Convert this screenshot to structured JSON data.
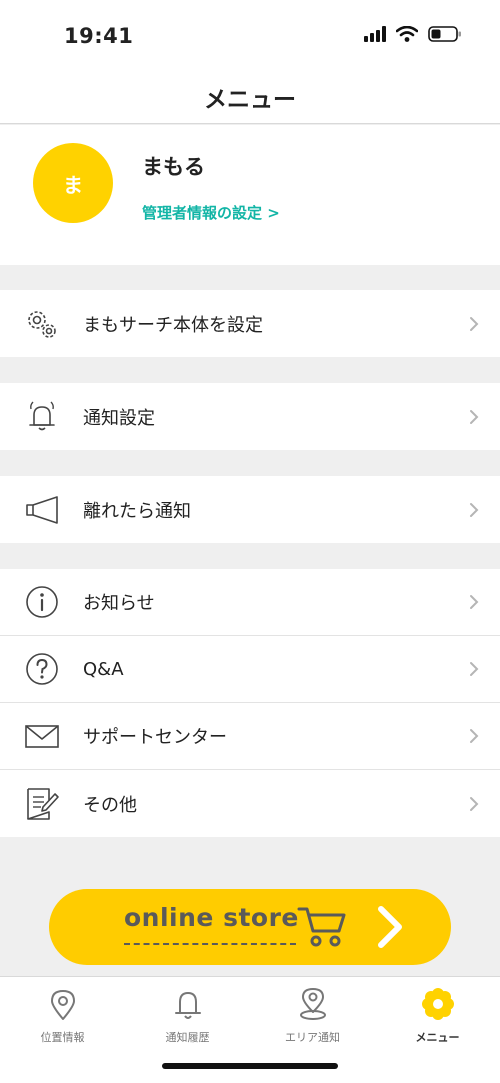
{
  "status_bar": {
    "time": "19:41"
  },
  "nav": {
    "title": "メニュー"
  },
  "profile": {
    "avatar_initial": "ま",
    "name": "まもる",
    "link": "管理者情報の設定 >"
  },
  "menu_groups": [
    {
      "items": [
        {
          "icon": "gear-icon",
          "label": "まもサーチ本体を設定"
        }
      ]
    },
    {
      "items": [
        {
          "icon": "bell-icon",
          "label": "通知設定"
        }
      ]
    },
    {
      "items": [
        {
          "icon": "megaphone-icon",
          "label": "離れたら通知"
        }
      ]
    },
    {
      "items": [
        {
          "icon": "info-icon",
          "label": "お知らせ"
        },
        {
          "icon": "question-icon",
          "label": "Q&A"
        },
        {
          "icon": "mail-icon",
          "label": "サポートセンター"
        },
        {
          "icon": "note-edit-icon",
          "label": "その他"
        }
      ]
    }
  ],
  "store": {
    "label": "online store",
    "accent": "#ffcc00"
  },
  "tabs": [
    {
      "icon": "location-pin-icon",
      "label": "位置情報"
    },
    {
      "icon": "bell-icon",
      "label": "通知履歴"
    },
    {
      "icon": "area-pin-icon",
      "label": "エリア通知"
    },
    {
      "icon": "flower-icon",
      "label": "メニュー",
      "active": true
    }
  ],
  "colors": {
    "accent_yellow": "#ffd200",
    "link_teal": "#12b5a6"
  }
}
